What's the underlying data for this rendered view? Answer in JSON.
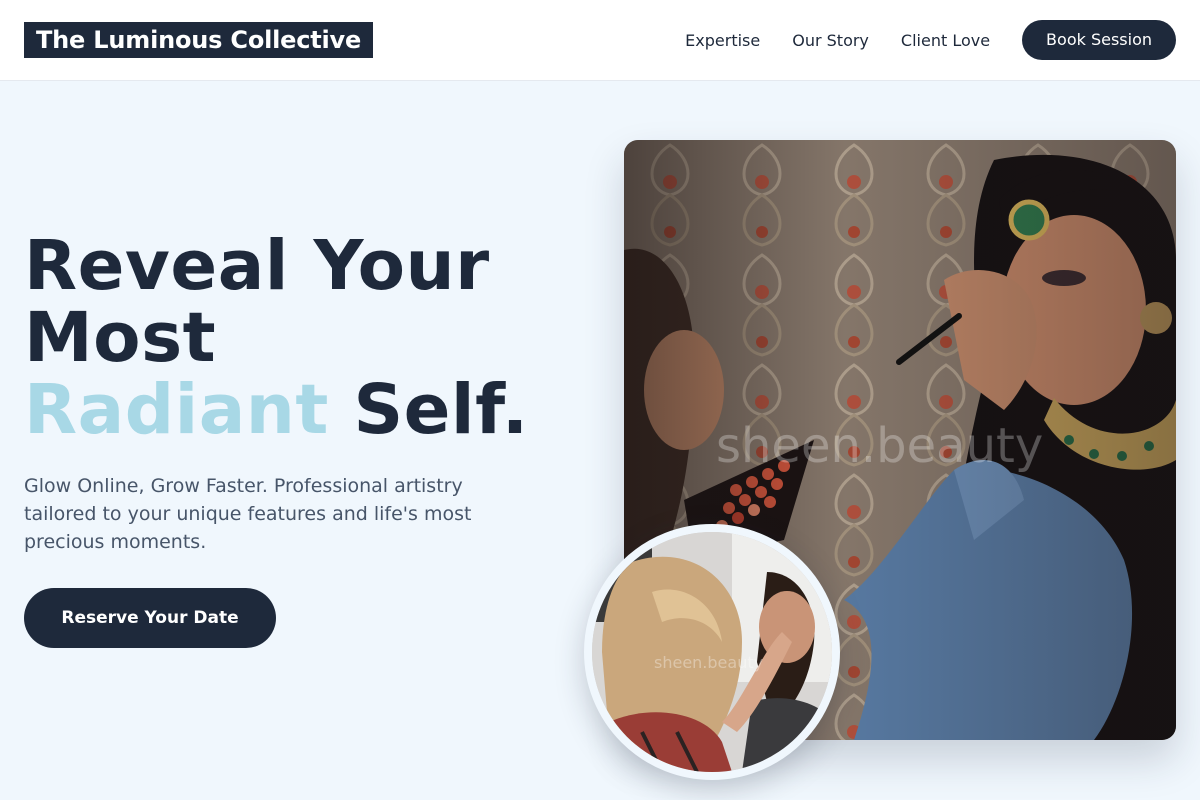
{
  "header": {
    "logo": "The Luminous Collective",
    "nav": [
      "Expertise",
      "Our Story",
      "Client Love"
    ],
    "cta": "Book Session"
  },
  "hero": {
    "headline_line1": "Reveal Your",
    "headline_line2": "Most",
    "headline_accent": "Radiant",
    "headline_end": "Self.",
    "subtext": "Glow Online, Grow Faster. Professional artistry tailored to your unique features and life's most precious moments.",
    "cta": "Reserve Your Date",
    "main_image_watermark": "sheen.beauty",
    "inset_image_watermark": "sheen.beauty"
  },
  "colors": {
    "primary": "#1e293b",
    "accent": "#a8d8e6",
    "background": "#f0f7fd",
    "text_muted": "#475569"
  }
}
